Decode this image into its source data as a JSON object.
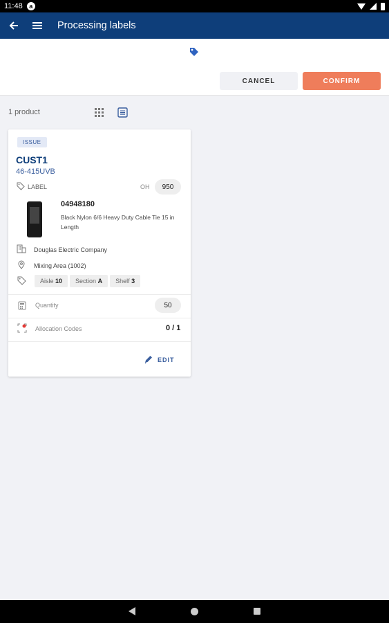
{
  "status_bar": {
    "time": "11:48",
    "notification": "a"
  },
  "app_bar": {
    "title": "Processing labels"
  },
  "actions": {
    "cancel_label": "CANCEL",
    "confirm_label": "CONFIRM"
  },
  "toolbar": {
    "product_count": "1 product"
  },
  "card": {
    "badge": "ISSUE",
    "customer": "CUST1",
    "sku": "46-415UVB",
    "label_type": "LABEL",
    "on_hand_label": "OH",
    "on_hand_value": "950",
    "product_number": "04948180",
    "product_description": "Black Nylon 6/6 Heavy Duty Cable Tie 15 in Length",
    "supplier": "Douglas Electric Company",
    "location": "Mixing Area (1002)",
    "aisle_label": "Aisle",
    "aisle_value": "10",
    "section_label": "Section",
    "section_value": "A",
    "shelf_label": "Shelf",
    "shelf_value": "3",
    "quantity_label": "Quantity",
    "quantity_value": "50",
    "allocation_label": "Allocation Codes",
    "allocation_value": "0 / 1",
    "edit_label": "EDIT"
  },
  "icons": {
    "back": "arrow-left-icon",
    "menu": "hamburger-menu-icon",
    "tag": "tag-icon",
    "grid_view": "grid-view-icon",
    "list_view": "list-view-icon",
    "building": "building-icon",
    "location": "location-pin-icon",
    "bin_tag": "tag-outline-icon",
    "quantity": "calculator-icon",
    "allocation": "allocation-alert-icon",
    "edit": "pencil-icon"
  },
  "colors": {
    "primary": "#0e3e7a",
    "accent": "#ef7d5b",
    "link": "#3a5e9e",
    "background": "#f1f2f6"
  }
}
